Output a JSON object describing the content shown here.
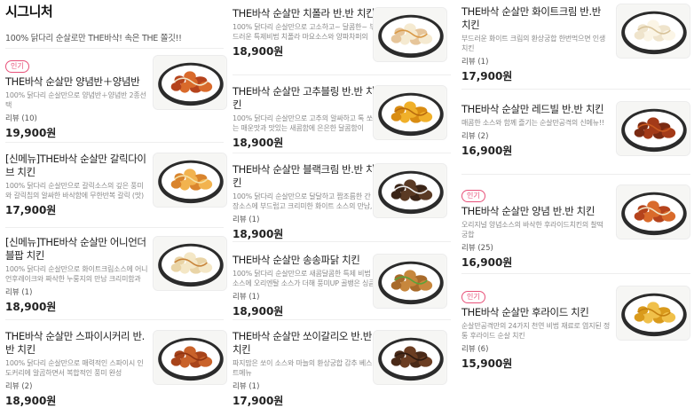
{
  "category": {
    "title": "시그니처",
    "description": "100% 닭다리 순살로만 THE바삭! 속은 THE 쫄깃!!"
  },
  "badge_label": "인기",
  "columns": [
    [
      {
        "badge": true,
        "name": "THE바삭 순살만 양념반＋양념반",
        "desc": "100% 닭다리 순살만으로 양념반＋양념반 2종선택",
        "review": "리뷰 (10)",
        "price": "19,900원",
        "img": "sauce"
      },
      {
        "badge": false,
        "name": "[신메뉴]THE바삭 순살만 갈릭다이브 치킨",
        "desc": "100% 닭다리 순살만으로 갈릭소스의 깊은 풍미와 갈릭칩의 알싸한 바삭함에 무한반복 갈릭 (맛)",
        "review": "",
        "price": "17,900원",
        "img": "garlic"
      },
      {
        "badge": false,
        "name": "[신메뉴]THE바삭 순살만 어니언더블팝 치킨",
        "desc": "100% 닭다리 순살만으로 화이트크림소스에 어니언후레이크와 짜삭한 누룽지의 만남 크리미함과",
        "review": "리뷰 (1)",
        "price": "18,900원",
        "img": "onion"
      },
      {
        "badge": false,
        "name": "THE바삭 순살만 스파이시커리 반.반 치킨",
        "desc": "100% 닭다리 순살만으로 매력적인 스파이시 인도커리에 알곰하면서 복합적인 풍미 완성",
        "review": "리뷰 (2)",
        "price": "18,900원",
        "img": "fried"
      }
    ],
    [
      {
        "badge": false,
        "name": "THE바삭 순살만 치폴라 반.반 치킨",
        "desc": "100% 닭다리 순살만으로 고소하고~ 달콤한~ 부드러운 특제비법 치폴라 마요소스와 양파차퍼의",
        "review": "",
        "price": "18,900원",
        "img": "mayo"
      },
      {
        "badge": false,
        "name": "THE바삭 순살만 고추블링 반.반 치킨",
        "desc": "100% 닭다리 순살만으로 고추의 알싸하고 톡 쏘는 매운맛과 맛있는 새콤함에 은은한 달콤함이",
        "review": "",
        "price": "18,900원",
        "img": "yellow"
      },
      {
        "badge": false,
        "name": "THE바삭 순살만 블랙크림 반.반 치킨",
        "desc": "100% 닭다리 순살만으로 달달하고 짭조름한 간장소스에 부드럽고 크리미한 화이트 소스의 만남,",
        "review": "리뷰 (1)",
        "price": "18,900원",
        "img": "black"
      },
      {
        "badge": false,
        "name": "THE바삭 순살만 송송파닭 치킨",
        "desc": "100% 닭다리 순살만으로 새콤달콤한 특제 비법소스에 오리엔탈 소스가 더해 풍미UP 골뱅은 싱큼",
        "review": "리뷰 (1)",
        "price": "18,900원",
        "img": "green"
      },
      {
        "badge": false,
        "name": "THE바삭 순살만 쏘이갈리오 반.반 치킨",
        "desc": "파지맘은 쏘이 소스와 마늘의 환상궁합 감추 베스트메뉴",
        "review": "리뷰 (1)",
        "price": "17,900원",
        "img": "soy"
      }
    ],
    [
      {
        "badge": false,
        "name": "THE바삭 순살만 화이트크림 반.반 치킨",
        "desc": "부드러운 화이트 크림의 환상궁합 한번먹으면 인생치킨",
        "review": "리뷰 (1)",
        "price": "17,900원",
        "img": "white"
      },
      {
        "badge": false,
        "name": "THE바삭 순살만 레드빌 반.반 치킨",
        "desc": "매콤한 소스와 함께 즐기는 순살만공격의 신메뉴!!",
        "review": "리뷰 (2)",
        "price": "16,900원",
        "img": "red"
      },
      {
        "badge": true,
        "name": "THE바삭 순살만 양념 반.반 치킨",
        "desc": "오리지널 양념소스의 바삭한 후라이드치킨의 찰떡 궁합",
        "review": "리뷰 (25)",
        "price": "16,900원",
        "img": "sauce"
      },
      {
        "badge": true,
        "name": "THE바삭 순살만 후라이드 치킨",
        "desc": "순살만공격만의 24가지 천연 비법 재료로 염지된 정통 후라이드 순살 치킨",
        "review": "리뷰 (6)",
        "price": "15,900원",
        "img": "crispy"
      }
    ]
  ],
  "colors": {
    "badge": "#e8527a",
    "price": "#222222",
    "muted": "#8a8a8a"
  }
}
